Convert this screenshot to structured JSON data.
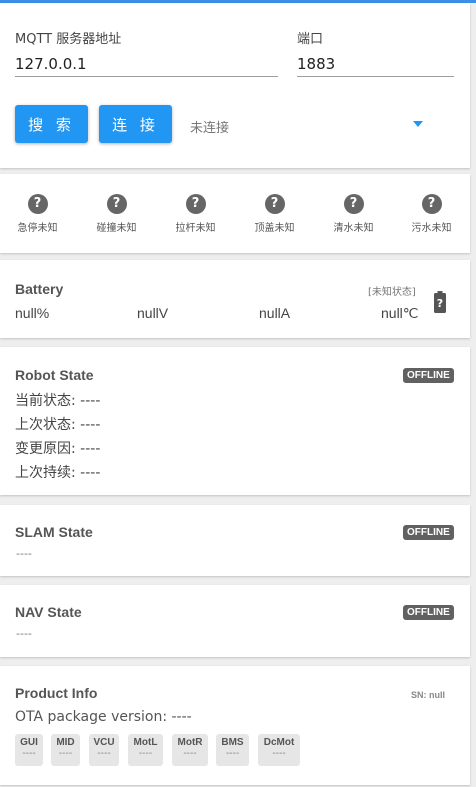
{
  "connection": {
    "server_label": "MQTT 服务器地址",
    "server_value": "127.0.0.1",
    "port_label": "端口",
    "port_value": "1883",
    "search_label": "搜 索",
    "connect_label": "连 接",
    "status": "未连接"
  },
  "sensors": [
    {
      "label": "急停未知"
    },
    {
      "label": "碰撞未知"
    },
    {
      "label": "拉杆未知"
    },
    {
      "label": "顶盖未知"
    },
    {
      "label": "清水未知"
    },
    {
      "label": "污水未知"
    }
  ],
  "sensor_icon": "help-circle-icon",
  "battery": {
    "title": "Battery",
    "status": "[未知状态]",
    "percent": "null%",
    "voltage": "nullV",
    "current": "nullA",
    "temperature": "null℃",
    "icon": "battery-unknown-icon"
  },
  "robot_state": {
    "title": "Robot State",
    "badge": "OFFLINE",
    "current_state": "当前状态: ----",
    "last_state": "上次状态: ----",
    "change_reason": "变更原因: ----",
    "last_duration": "上次持续: ----"
  },
  "slam_state": {
    "title": "SLAM State",
    "badge": "OFFLINE",
    "value": "----"
  },
  "nav_state": {
    "title": "NAV State",
    "badge": "OFFLINE",
    "value": "----"
  },
  "product_info": {
    "title": "Product Info",
    "sn": "SN: null",
    "ota": "OTA package version: ----",
    "modules": [
      {
        "name": "GUI",
        "value": "----"
      },
      {
        "name": "MID",
        "value": "----"
      },
      {
        "name": "VCU",
        "value": "----"
      },
      {
        "name": "MotL",
        "value": "----"
      },
      {
        "name": "MotR",
        "value": "----"
      },
      {
        "name": "BMS",
        "value": "----"
      },
      {
        "name": "DcMot",
        "value": "----"
      }
    ]
  },
  "colors": {
    "accent": "#2196f3",
    "badge": "#616161",
    "topbar": "#3b8fe6"
  }
}
